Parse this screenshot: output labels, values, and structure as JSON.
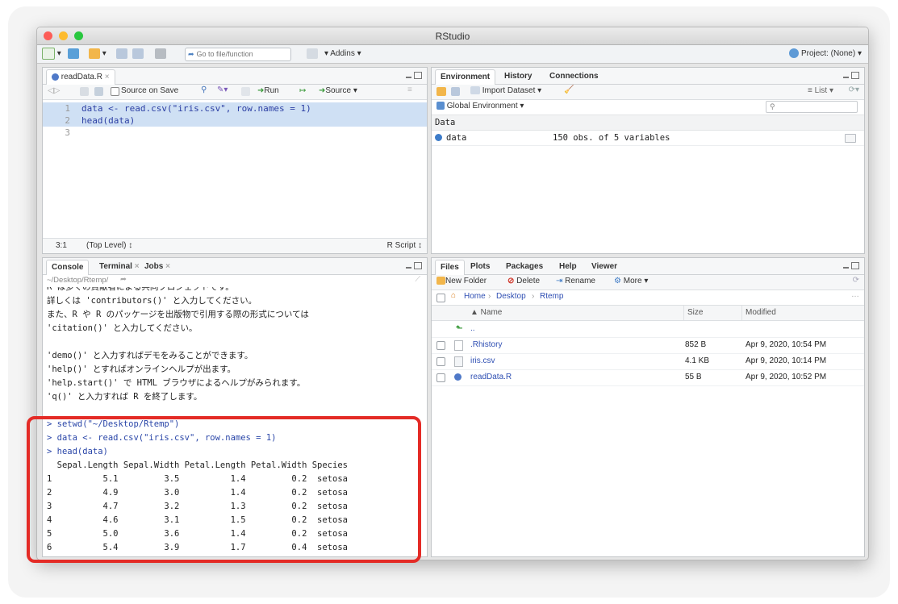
{
  "window": {
    "title": "RStudio"
  },
  "toolbar": {
    "goto_placeholder": "Go to file/function",
    "addins_label": "Addins",
    "project_label": "Project: (None)"
  },
  "source": {
    "tab_label": "readData.R",
    "source_on_save": "Source on Save",
    "run_label": "Run",
    "source_label": "Source",
    "lines": [
      {
        "num": "1",
        "text": "data <- read.csv(\"iris.csv\", row.names = 1)"
      },
      {
        "num": "2",
        "text": "head(data)"
      },
      {
        "num": "3",
        "text": ""
      }
    ],
    "status_pos": "3:1",
    "status_level": "(Top Level) ↕",
    "status_type": "R Script ↕"
  },
  "console": {
    "tabs": [
      "Console",
      "Terminal",
      "Jobs"
    ],
    "path": "~/Desktop/Rtemp/",
    "lines": [
      "R は多くの貢献者による共同プロジェクトです。",
      "詳しくは 'contributors()' と入力してください。",
      "また、R や R のパッケージを出版物で引用する際の形式については",
      "'citation()' と入力してください。",
      "",
      "'demo()' と入力すればデモをみることができます。",
      "'help()' とすればオンラインヘルプが出ます。",
      "'help.start()' で HTML ブラウザによるヘルプがみられます。",
      "'q()' と入力すれば R を終了します。",
      "",
      "> setwd(\"~/Desktop/Rtemp\")",
      "> data <- read.csv(\"iris.csv\", row.names = 1)",
      "> head(data)",
      "  Sepal.Length Sepal.Width Petal.Length Petal.Width Species",
      "1          5.1         3.5          1.4         0.2  setosa",
      "2          4.9         3.0          1.4         0.2  setosa",
      "3          4.7         3.2          1.3         0.2  setosa",
      "4          4.6         3.1          1.5         0.2  setosa",
      "5          5.0         3.6          1.4         0.2  setosa",
      "6          5.4         3.9          1.7         0.4  setosa",
      "> "
    ]
  },
  "environment": {
    "tabs": [
      "Environment",
      "History",
      "Connections"
    ],
    "import_label": "Import Dataset",
    "list_label": "List",
    "scope_label": "Global Environment",
    "section": "Data",
    "rows": [
      {
        "name": "data",
        "value": "150 obs. of 5 variables"
      }
    ]
  },
  "files": {
    "tabs": [
      "Files",
      "Plots",
      "Packages",
      "Help",
      "Viewer"
    ],
    "new_folder": "New Folder",
    "delete": "Delete",
    "rename": "Rename",
    "more": "More",
    "breadcrumb": [
      "Home",
      "Desktop",
      "Rtemp"
    ],
    "headers": {
      "name": "▲ Name",
      "size": "Size",
      "modified": "Modified"
    },
    "up_label": "..",
    "rows": [
      {
        "name": ".Rhistory",
        "size": "852 B",
        "modified": "Apr 9, 2020, 10:54 PM"
      },
      {
        "name": "iris.csv",
        "size": "4.1 KB",
        "modified": "Apr 9, 2020, 10:14 PM"
      },
      {
        "name": "readData.R",
        "size": "55 B",
        "modified": "Apr 9, 2020, 10:52 PM"
      }
    ]
  }
}
